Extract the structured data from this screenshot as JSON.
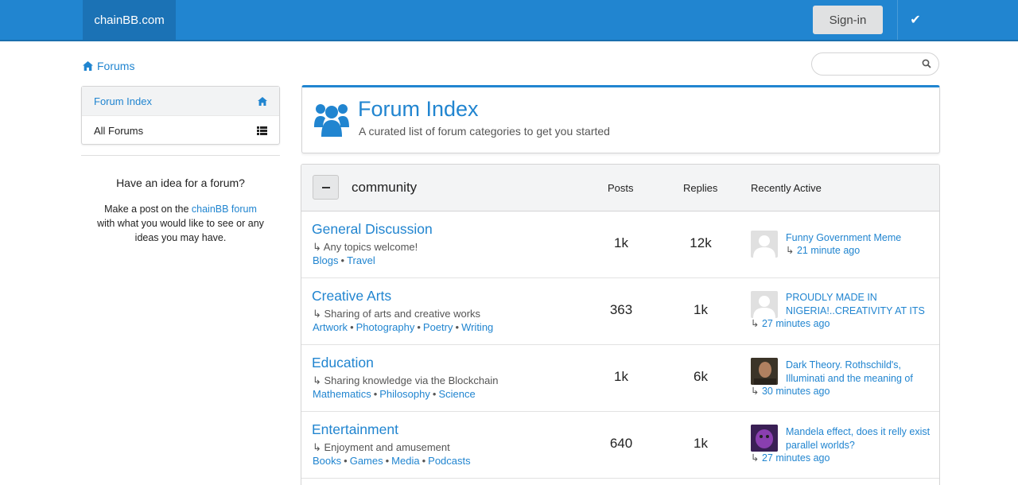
{
  "topbar": {
    "brand": "chainBB.com",
    "signin_label": "Sign-in",
    "check_icon": "✔"
  },
  "breadcrumb": {
    "label": "Forums",
    "icon": "home-icon"
  },
  "search": {
    "placeholder": "",
    "value": ""
  },
  "sidebar": {
    "items": [
      {
        "label": "Forum Index",
        "icon": "home-icon",
        "active": true
      },
      {
        "label": "All Forums",
        "icon": "list-icon",
        "active": false
      }
    ],
    "idea_title": "Have an idea for a forum?",
    "idea_text_before": "Make a post on the ",
    "idea_link": "chainBB forum",
    "idea_text_after": " with what you would like to see or any ideas you may have."
  },
  "header": {
    "title": "Forum Index",
    "subtitle": "A curated list of forum categories to get you started",
    "icon": "users-icon"
  },
  "forum_table": {
    "category": "community",
    "collapse_label": "−",
    "columns": {
      "posts": "Posts",
      "replies": "Replies",
      "recent": "Recently Active"
    },
    "rows": [
      {
        "title": "General Discussion",
        "description": "↳ Any topics welcome!",
        "tags": [
          "Blogs",
          "Travel"
        ],
        "posts": "1k",
        "replies": "12k",
        "recent_title": "Funny Government Meme",
        "recent_time": "21 minute ago",
        "avatar": "placeholder"
      },
      {
        "title": "Creative Arts",
        "description": "↳ Sharing of arts and creative works",
        "tags": [
          "Artwork",
          "Photography",
          "Poetry",
          "Writing"
        ],
        "posts": "363",
        "replies": "1k",
        "recent_title": "PROUDLY MADE IN NIGERIA!..CREATIVITY AT ITS",
        "recent_time": "27 minutes ago",
        "avatar": "placeholder"
      },
      {
        "title": "Education",
        "description": "↳ Sharing knowledge via the Blockchain",
        "tags": [
          "Mathematics",
          "Philosophy",
          "Science"
        ],
        "posts": "1k",
        "replies": "6k",
        "recent_title": "Dark Theory. Rothschild's, Illuminati and the meaning of",
        "recent_time": "30 minutes ago",
        "avatar": "photo"
      },
      {
        "title": "Entertainment",
        "description": "↳ Enjoyment and amusement",
        "tags": [
          "Books",
          "Games",
          "Media",
          "Podcasts"
        ],
        "posts": "640",
        "replies": "1k",
        "recent_title": "Mandela effect, does it relly exist parallel worlds?",
        "recent_time": "27 minutes ago",
        "avatar": "purple"
      }
    ]
  },
  "colors": {
    "primary": "#2185d0",
    "brand_bg": "#1b72b5",
    "header_bg": "#f3f4f5"
  }
}
